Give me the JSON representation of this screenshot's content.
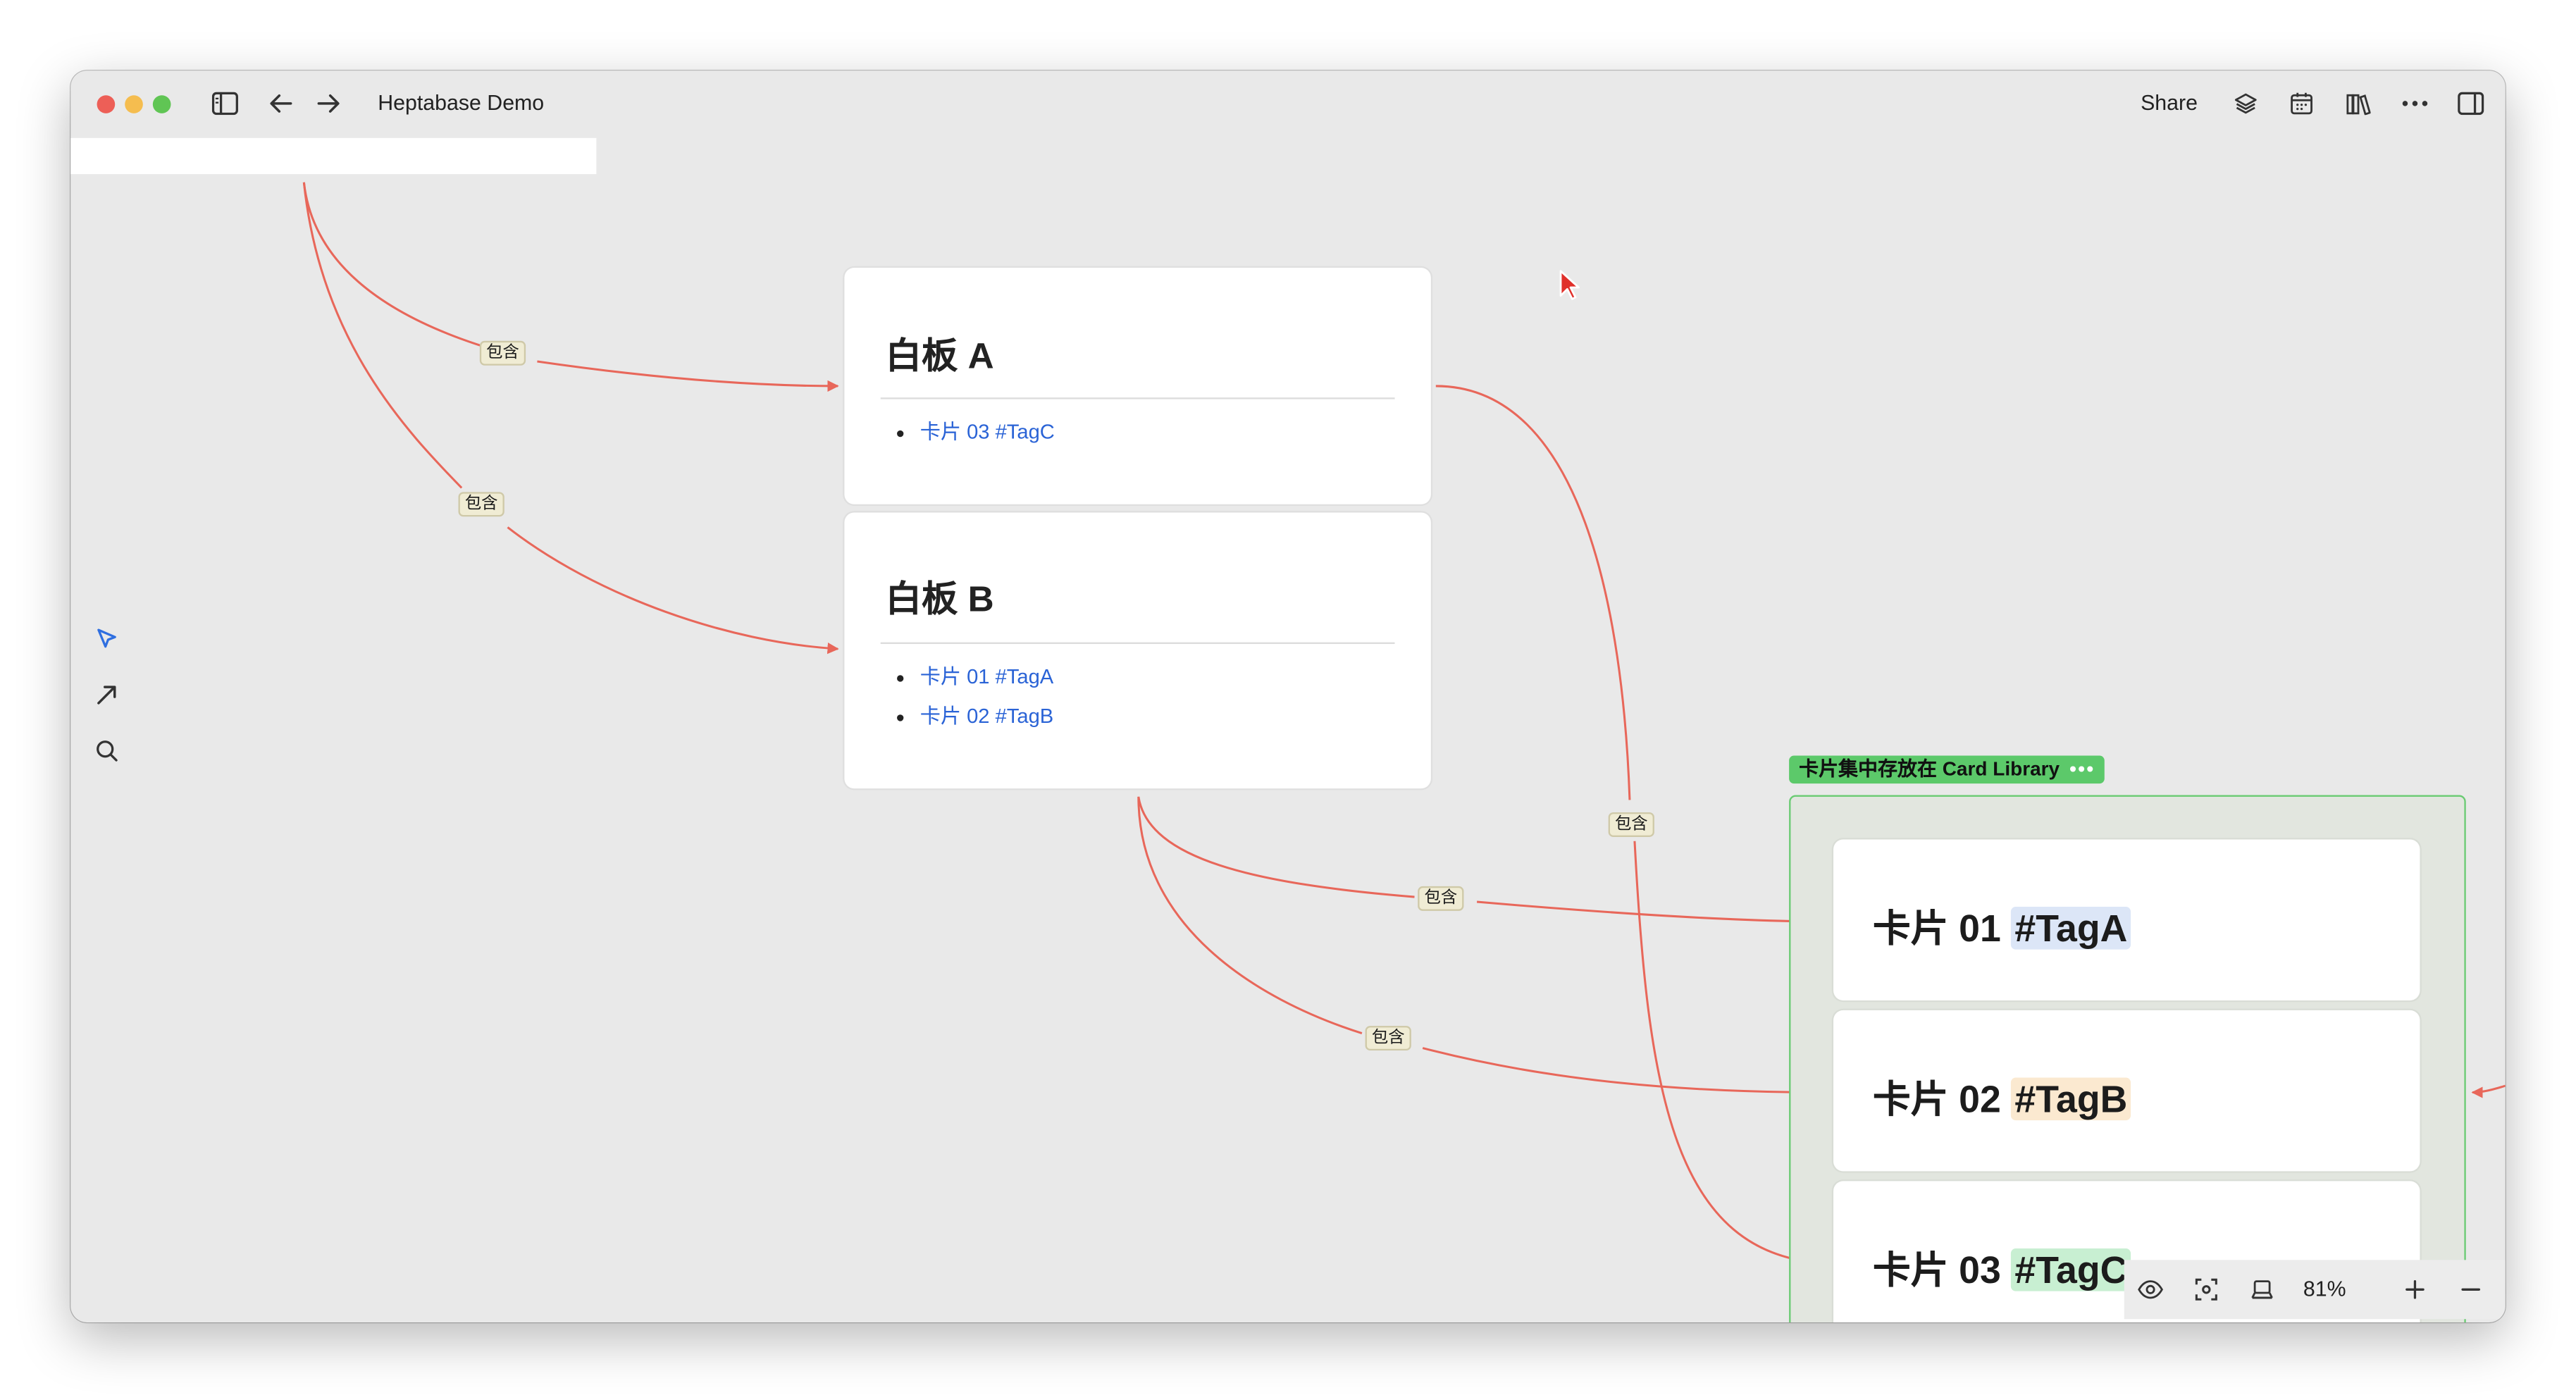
{
  "window": {
    "title": "Heptabase Demo"
  },
  "toolbar": {
    "share_label": "Share"
  },
  "edges": {
    "label": "包含"
  },
  "whiteboards": [
    {
      "title": "白板 A",
      "items": [
        "卡片 03 #TagC"
      ]
    },
    {
      "title": "白板 B",
      "items": [
        "卡片 01 #TagA",
        "卡片 02 #TagB"
      ]
    }
  ],
  "group": {
    "label": "卡片集中存放在 Card Library",
    "menu": "•••"
  },
  "cards": [
    {
      "name": "卡片 01",
      "tag": "#TagA",
      "tag_color": "#dce6f7"
    },
    {
      "name": "卡片 02",
      "tag": "#TagB",
      "tag_color": "#fbe9d0"
    },
    {
      "name": "卡片 03",
      "tag": "#TagC",
      "tag_color": "#c8efd2"
    }
  ],
  "zoom": {
    "level": "81%"
  },
  "colors": {
    "edge": "#e8675a",
    "link": "#2a63d6",
    "group": "#5cc96a"
  }
}
